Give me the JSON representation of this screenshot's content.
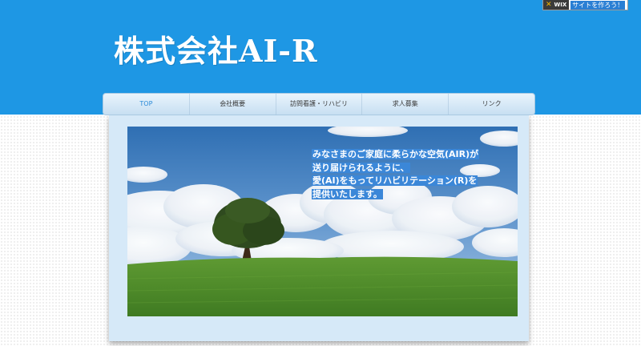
{
  "header": {
    "title": "株式会社AI-R",
    "bg_color": "#1e97e4"
  },
  "wix_badge": {
    "brand": "WIX",
    "label": "サイトを作ろう！"
  },
  "nav": {
    "items": [
      {
        "label": "TOP",
        "active": true
      },
      {
        "label": "会社概要",
        "active": false
      },
      {
        "label": "訪問看護・リハビリ",
        "active": false
      },
      {
        "label": "求人募集",
        "active": false
      },
      {
        "label": "リンク",
        "active": false
      }
    ]
  },
  "hero": {
    "image": "tree-on-green-field-under-blue-sky",
    "tagline_lines": [
      "みなさまのご家庭に柔らかな空気(AIR)が",
      "送り届けられるように、",
      "愛(AI)をもってリハビリテーション(R)を",
      "提供いたします。"
    ]
  }
}
